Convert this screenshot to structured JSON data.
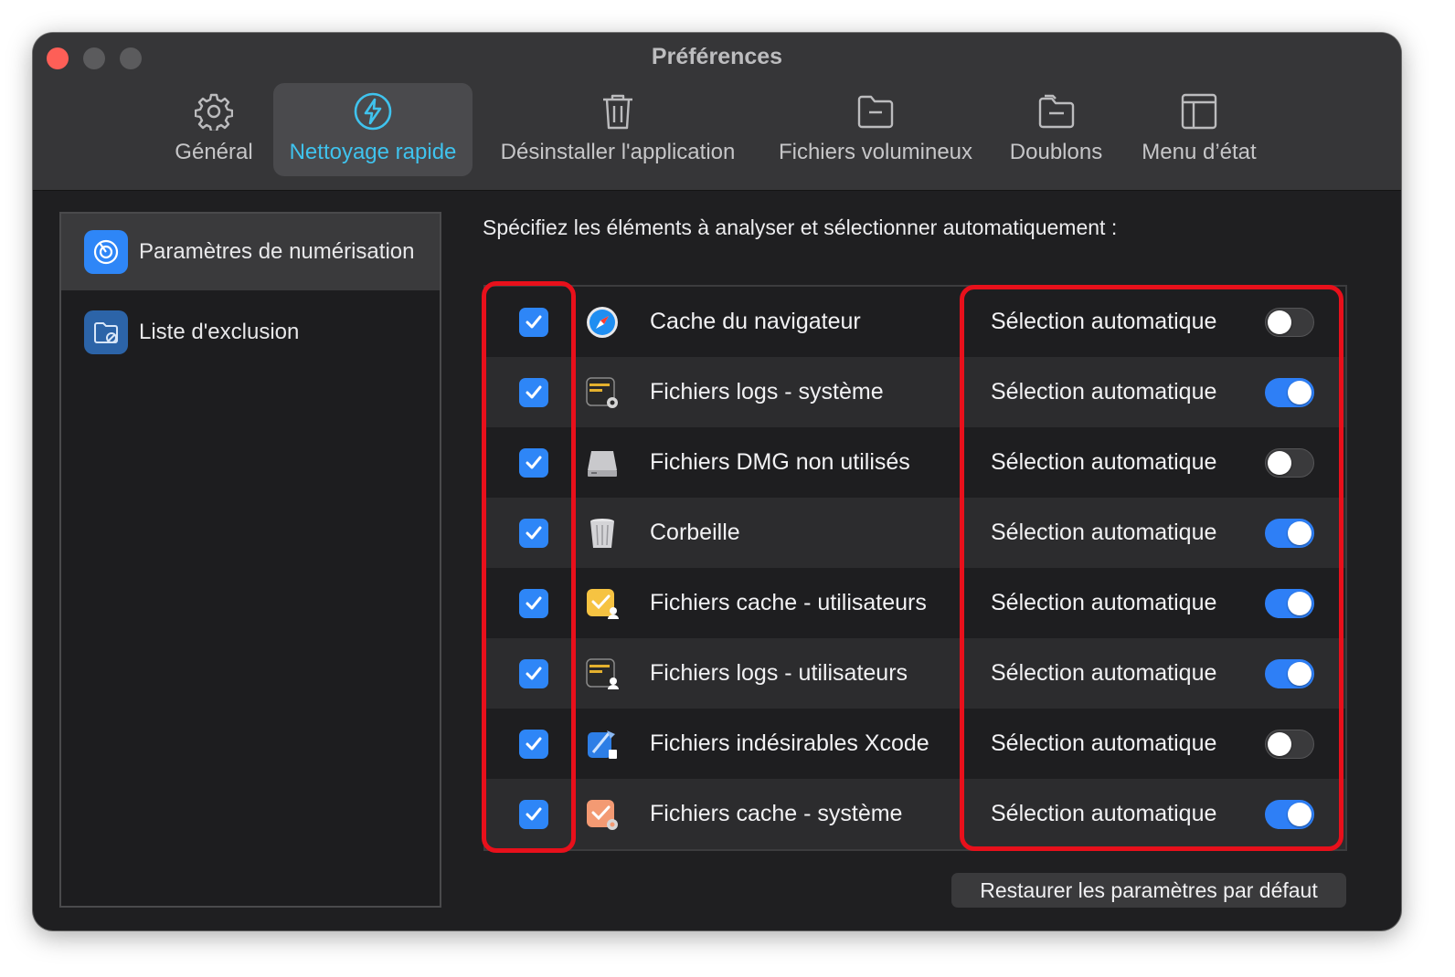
{
  "window": {
    "title": "Préférences"
  },
  "tabs": [
    {
      "label": "Général",
      "icon": "gear-icon",
      "active": false
    },
    {
      "label": "Nettoyage rapide",
      "icon": "lightning-icon",
      "active": true
    },
    {
      "label": "Désinstaller l'application",
      "icon": "trash-icon",
      "active": false
    },
    {
      "label": "Fichiers volumineux",
      "icon": "folder-icon",
      "active": false
    },
    {
      "label": "Doublons",
      "icon": "duplicate-folder-icon",
      "active": false
    },
    {
      "label": "Menu d’état",
      "icon": "layout-icon",
      "active": false
    }
  ],
  "sidebar": {
    "items": [
      {
        "label": "Paramètres de numérisation",
        "icon": "scan-icon",
        "selected": true
      },
      {
        "label": "Liste d'exclusion",
        "icon": "exclusion-folder-icon",
        "selected": false
      }
    ]
  },
  "main": {
    "headline": "Spécifiez les éléments à analyser et sélectionner automatiquement :",
    "rows": [
      {
        "label": "Cache du navigateur",
        "icon": "safari-icon",
        "checked": true,
        "auto_label": "Sélection automatique",
        "auto": false
      },
      {
        "label": "Fichiers logs - système",
        "icon": "console-icon",
        "checked": true,
        "auto_label": "Sélection automatique",
        "auto": true
      },
      {
        "label": "Fichiers DMG non utilisés",
        "icon": "disk-image-icon",
        "checked": true,
        "auto_label": "Sélection automatique",
        "auto": false
      },
      {
        "label": "Corbeille",
        "icon": "trash-can-icon",
        "checked": true,
        "auto_label": "Sélection automatique",
        "auto": true
      },
      {
        "label": "Fichiers cache - utilisateurs",
        "icon": "user-cache-icon",
        "checked": true,
        "auto_label": "Sélection automatique",
        "auto": true
      },
      {
        "label": "Fichiers logs - utilisateurs",
        "icon": "user-console-icon",
        "checked": true,
        "auto_label": "Sélection automatique",
        "auto": true
      },
      {
        "label": "Fichiers indésirables Xcode",
        "icon": "xcode-icon",
        "checked": true,
        "auto_label": "Sélection automatique",
        "auto": false
      },
      {
        "label": "Fichiers cache - système",
        "icon": "system-cache-icon",
        "checked": true,
        "auto_label": "Sélection automatique",
        "auto": true
      }
    ],
    "restore_label": "Restaurer les paramètres par défaut"
  },
  "colors": {
    "accent": "#2e86f7",
    "active_tab_text": "#3fc3ee",
    "highlight": "#e8101b"
  }
}
